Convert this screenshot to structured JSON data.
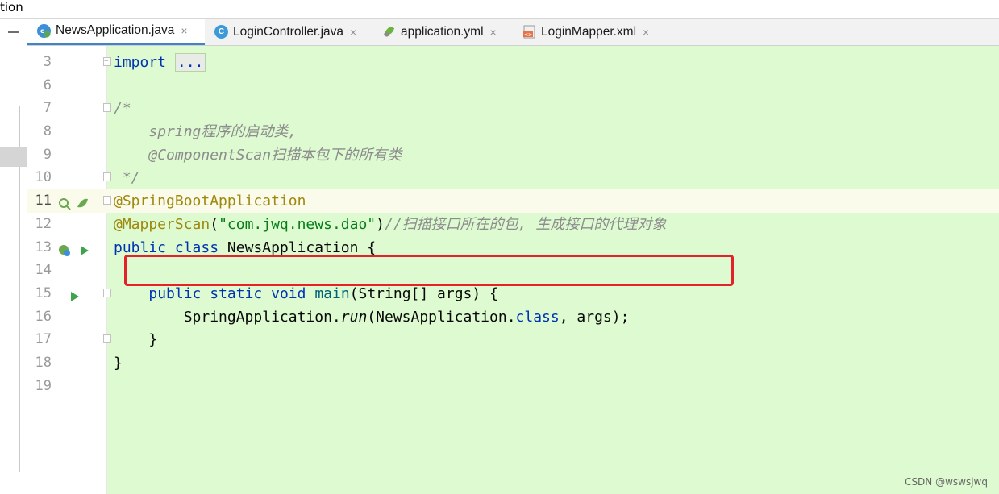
{
  "top_strip": {
    "text": "tion"
  },
  "tabs": [
    {
      "label": "NewsApplication.java",
      "icon": "spring-class-icon",
      "active": true
    },
    {
      "label": "LoginController.java",
      "icon": "class-icon",
      "active": false
    },
    {
      "label": "application.yml",
      "icon": "spring-yml-icon",
      "active": false
    },
    {
      "label": "LoginMapper.xml",
      "icon": "xml-file-icon",
      "active": false
    }
  ],
  "tab_close_glyph": "×",
  "line_numbers": [
    "3",
    "6",
    "7",
    "8",
    "9",
    "10",
    "11",
    "12",
    "13",
    "14",
    "15",
    "16",
    "17",
    "18",
    "19"
  ],
  "code": {
    "l3_kw": "import",
    "l3_dots": "...",
    "l7": "/*",
    "l8_a": "spring",
    "l8_b": "程序的启动类,",
    "l9_a": "@ComponentScan",
    "l9_b": "扫描本包下的所有类",
    "l10": " */",
    "l11": "@SpringBootApplication",
    "l12_ann": "@MapperScan",
    "l12_open": "(",
    "l12_str": "\"com.jwq.news.dao\"",
    "l12_close": ")",
    "l12_comment": "//扫描接口所在的包, 生成接口的代理对象",
    "l13_kw1": "public",
    "l13_kw2": "class",
    "l13_name": " NewsApplication {",
    "l15_kw1": "public",
    "l15_kw2": "static",
    "l15_kw3": "void",
    "l15_mth": "main",
    "l15_rest": "(String[] args) {",
    "l16_a": "SpringApplication.",
    "l16_run": "run",
    "l16_b": "(NewsApplication.",
    "l16_cls": "class",
    "l16_c": ", args);",
    "l17": "}",
    "l18": "}"
  },
  "watermark": "CSDN @wswsjwq",
  "colors": {
    "editor_bg": "#ddfad0",
    "keyword": "#0033b3",
    "annotation": "#9e880d",
    "string": "#067d17",
    "comment": "#8c8c8c",
    "highlight_box": "#e5222a"
  }
}
